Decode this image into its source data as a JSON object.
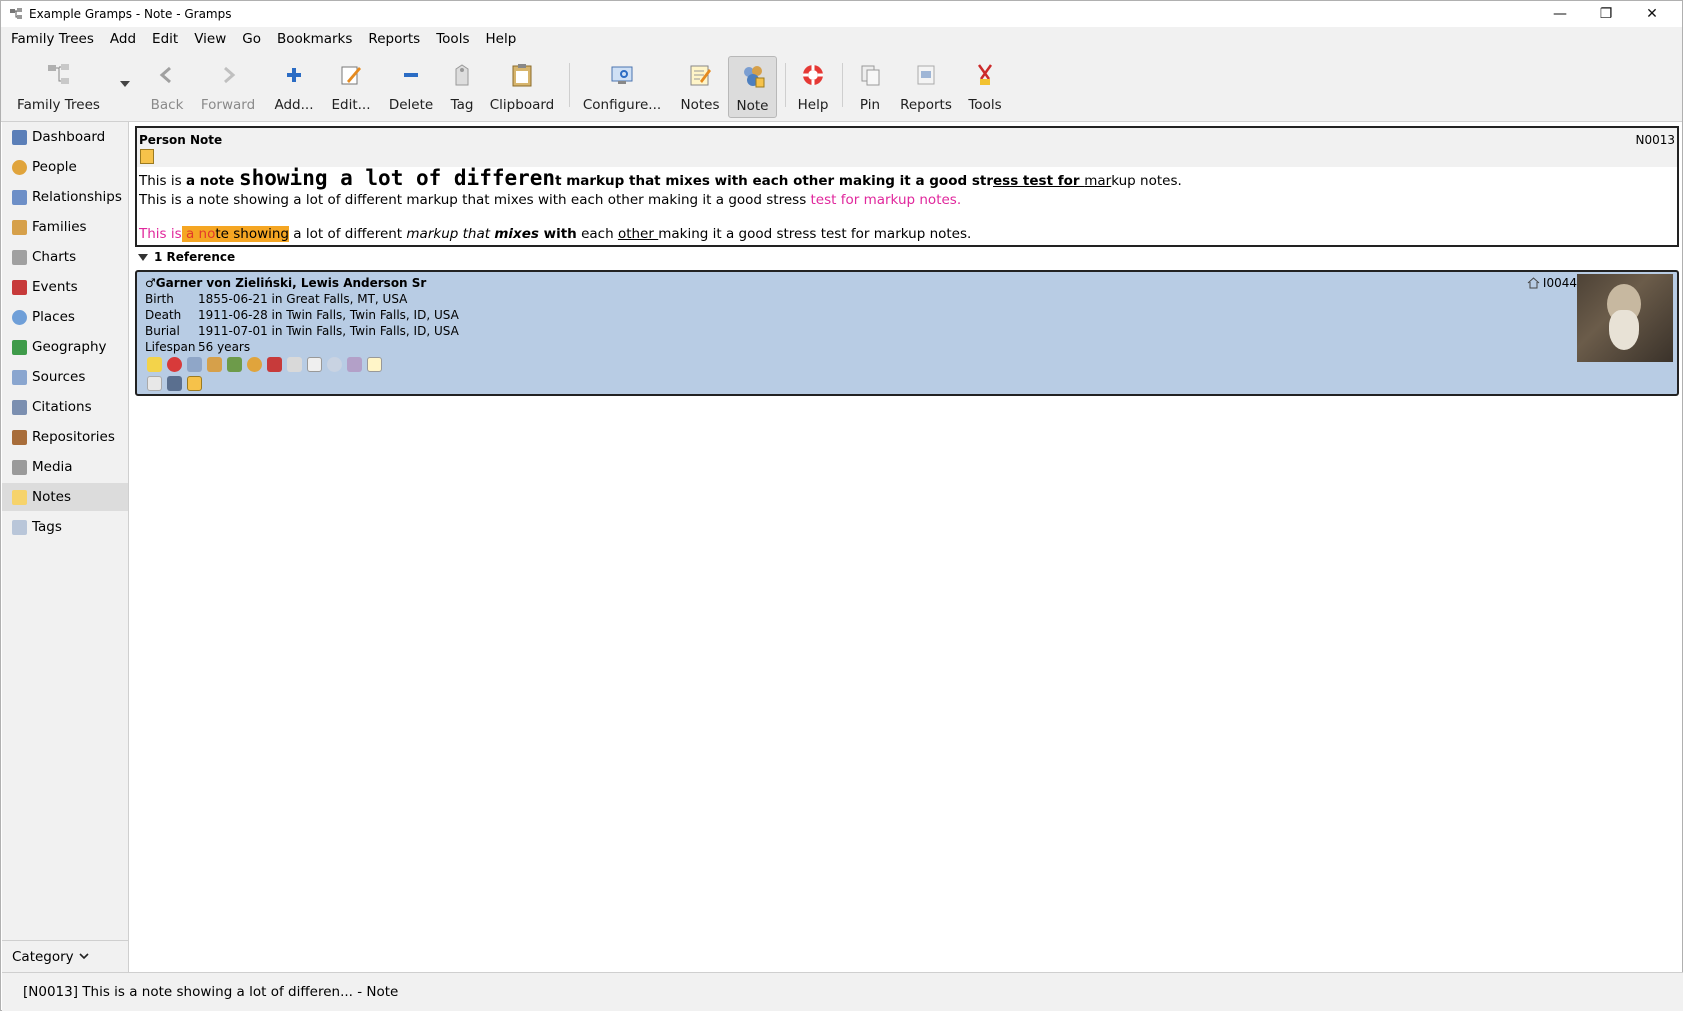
{
  "window": {
    "title": "Example Gramps - Note - Gramps",
    "controls": {
      "minimize": "—",
      "restore": "❐",
      "close": "✕"
    }
  },
  "menubar": [
    "Family Trees",
    "Add",
    "Edit",
    "View",
    "Go",
    "Bookmarks",
    "Reports",
    "Tools",
    "Help"
  ],
  "toolbar": {
    "family_trees": "Family Trees",
    "back": "Back",
    "forward": "Forward",
    "add": "Add...",
    "edit": "Edit...",
    "delete": "Delete",
    "tag": "Tag",
    "clipboard": "Clipboard",
    "configure": "Configure...",
    "notes": "Notes",
    "note": "Note",
    "help": "Help",
    "pin": "Pin",
    "reports": "Reports",
    "tools": "Tools"
  },
  "sidebar": {
    "items": [
      "Dashboard",
      "People",
      "Relationships",
      "Families",
      "Charts",
      "Events",
      "Places",
      "Geography",
      "Sources",
      "Citations",
      "Repositories",
      "Media",
      "Notes",
      "Tags"
    ],
    "selected": "Notes",
    "category": "Category"
  },
  "note": {
    "header": "Person Note",
    "id": "N0013",
    "line1": {
      "a": "This is ",
      "b": "a note ",
      "c": "showing a lot of differen",
      "d": "t markup that mixes with each other making it a good str",
      "e": "ess test for ",
      "f": "mar",
      "g": "kup notes."
    },
    "line2": {
      "a": "This is a note showing a lot of different markup that mixes with each other making it a good stress ",
      "b": "test for markup notes."
    },
    "line3": {
      "a": "This is",
      "b": " a no",
      "c": "te showing",
      "d": " a lot of different ",
      "e": "markup that ",
      "f": "mixes",
      "g": " with",
      "h": " each ",
      "i": "other ",
      "j": "making it a good stress test for markup notes."
    }
  },
  "references": {
    "header": "1 Reference",
    "person": {
      "name": "Garner von Zieliński, Lewis Anderson Sr",
      "id": "I0044",
      "rows": [
        {
          "label": "Birth",
          "value": "1855-06-21 in Great Falls, MT, USA"
        },
        {
          "label": "Death",
          "value": "1911-06-28 in Twin Falls, Twin Falls, ID, USA"
        },
        {
          "label": "Burial",
          "value": "1911-07-01 in Twin Falls, Twin Falls, ID, USA"
        },
        {
          "label": "Lifespan",
          "value": "56 years"
        }
      ]
    }
  },
  "statusbar": "[N0013] This is a note showing a lot of differen... - Note"
}
